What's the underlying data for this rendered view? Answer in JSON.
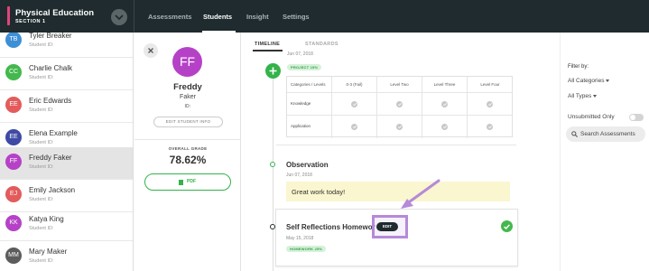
{
  "course": {
    "title": "Physical Education",
    "section": "SECTION 1"
  },
  "nav": {
    "items": [
      "Assessments",
      "Students",
      "Insight",
      "Settings"
    ],
    "active": "Students"
  },
  "students": [
    {
      "initials": "TB",
      "name": "Tyler Breaker",
      "id_label": "Student ID:",
      "color": "#3d8fd6"
    },
    {
      "initials": "CC",
      "name": "Charlie Chalk",
      "id_label": "Student ID:",
      "color": "#44b84e"
    },
    {
      "initials": "EE",
      "name": "Eric Edwards",
      "id_label": "Student ID:",
      "color": "#e35b5b"
    },
    {
      "initials": "EE",
      "name": "Elena Example",
      "id_label": "Student ID:",
      "color": "#3f4aa5"
    },
    {
      "initials": "FF",
      "name": "Freddy Faker",
      "id_label": "Student ID:",
      "color": "#b542c6"
    },
    {
      "initials": "EJ",
      "name": "Emily Jackson",
      "id_label": "Student ID:",
      "color": "#e35b5b"
    },
    {
      "initials": "KK",
      "name": "Katya King",
      "id_label": "Student ID:",
      "color": "#b542c6"
    },
    {
      "initials": "MM",
      "name": "Mary Maker",
      "id_label": "Student ID:",
      "color": "#5c5c5c"
    }
  ],
  "profile": {
    "initials": "FF",
    "first_name": "Freddy",
    "last_name": "Faker",
    "id_label": "ID:",
    "edit_button": "EDIT STUDENT INFO",
    "grade_label": "OVERALL GRADE",
    "grade_value": "78.62%",
    "pdf_button": "PDF"
  },
  "tabs": {
    "timeline": "TIMELINE",
    "standards": "STANDARDS"
  },
  "timeline": {
    "top_date": "Jun 07, 2018",
    "top_pill": "PROJECT 15%",
    "rubric": {
      "headers": [
        "Categories / Levels",
        "0-3 (Fail)",
        "Level Two",
        "Level Three",
        "Level Four"
      ],
      "rows": [
        "Knowledge",
        "Application"
      ]
    },
    "observation": {
      "title": "Observation",
      "date": "Jun 07, 2018",
      "comment": "Great work today!"
    },
    "self_reflection": {
      "title": "Self Reflections Homewor",
      "date": "May 15, 2018",
      "pill": "HOMEWORK 25%",
      "edit_button": "EDIT"
    }
  },
  "filter": {
    "title": "Filter by:",
    "categories": "All Categories",
    "types": "All Types",
    "unsubmitted": "Unsubmitted Only",
    "search": "Search Assessments"
  },
  "colors": {
    "topbar": "#1f2b2e",
    "accent_pink": "#e0457b",
    "green": "#33b34a",
    "highlight_purple": "#b58ad9",
    "comment_bg": "#faf6cf"
  }
}
